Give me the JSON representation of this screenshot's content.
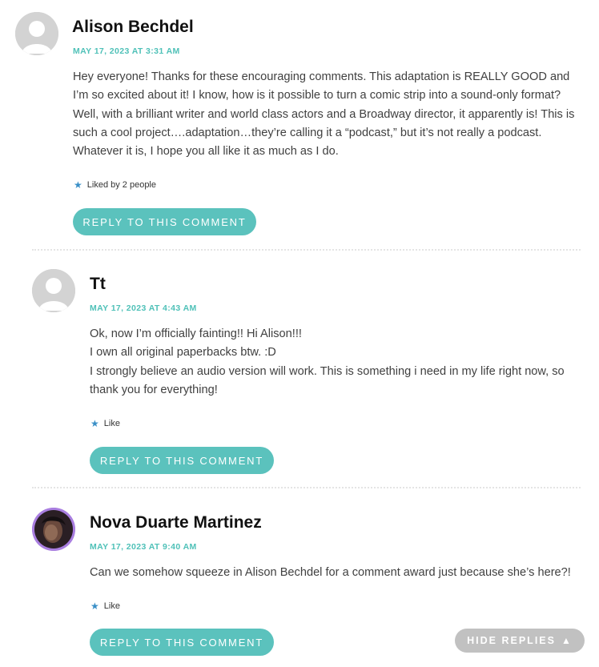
{
  "comments": [
    {
      "author": "Alison Bechdel",
      "date": "MAY 17, 2023 AT 3:31 AM",
      "paragraphs": [
        "Hey everyone! Thanks for these encouraging comments. This adaptation is REALLY GOOD and I’m so excited about it! I know, how is it possible to turn a comic strip into a sound-only format? Well, with a brilliant writer and world class actors and a Broadway director, it apparently is! This is such a cool project….adaptation…they’re calling it a “podcast,” but it’s not really a podcast. Whatever it is, I hope you all like it as much as I do."
      ],
      "likes": "Liked by 2 people",
      "reply": "REPLY TO THIS COMMENT",
      "avatar_icon": "default-avatar-icon"
    },
    {
      "author": "Tt",
      "date": "MAY 17, 2023 AT 4:43 AM",
      "paragraphs": [
        "Ok, now I’m officially fainting!! Hi Alison!!!",
        "I own all original paperbacks btw. :D",
        "I strongly believe an audio version will work. This is something i need in my life right now, so thank you for everything!"
      ],
      "likes": "Like",
      "reply": "REPLY TO THIS COMMENT",
      "avatar_icon": "default-avatar-icon"
    },
    {
      "author": "Nova Duarte Martinez",
      "date": "MAY 17, 2023 AT 9:40 AM",
      "paragraphs": [
        "Can we somehow squeeze in Alison Bechdel for a comment award just because she’s here?!"
      ],
      "likes": "Like",
      "reply": "REPLY TO THIS COMMENT",
      "avatar_icon": "user-photo-avatar"
    }
  ],
  "hide_replies": "HIDE REPLIES",
  "colors": {
    "accent": "#5bc2bd",
    "date": "#4fc1b8",
    "like_star": "#3a8fc7",
    "hide_button": "#c1c1c1",
    "avatar_ring": "#a97ee0"
  }
}
